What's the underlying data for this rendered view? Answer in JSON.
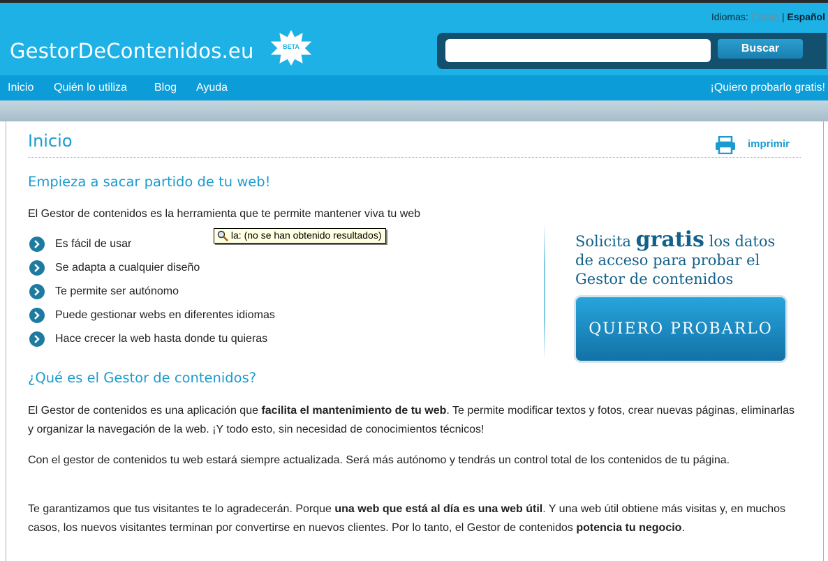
{
  "header": {
    "languages_label": "Idiomas:",
    "lang_catala": "Català",
    "lang_separator": "|",
    "lang_espanol": "Español",
    "logo_text": "GestorDeContenidos.eu",
    "beta_label": "BETA",
    "search": {
      "value": "",
      "button_label": "Buscar"
    }
  },
  "nav": {
    "items": [
      "Inicio",
      "Quién lo utiliza",
      "Blog",
      "Ayuda"
    ],
    "cta": "¡Quiero probarlo gratis!"
  },
  "main": {
    "title": "Inicio",
    "print_label": "imprimir",
    "heading1": "Empieza a sacar partido de tu web!",
    "intro": "El Gestor de contenidos es la herramienta que te permite mantener viva tu web",
    "bullets": [
      "Es fácil de usar",
      "Se adapta a cualquier diseño",
      "Te permite ser autónomo",
      "Puede gestionar webs en diferentes idiomas",
      "Hace crecer la web hasta donde tu quieras"
    ],
    "tooltip": "la: (no se han obtenido resultados)",
    "heading2": "¿Qué es el Gestor de contenidos?",
    "p1": {
      "a": "El Gestor de contenidos es una aplicación que ",
      "b": "facilita el mantenimiento de tu web",
      "c": ". Te permite modificar textos y fotos, crear nuevas páginas, eliminarlas y organizar la navegación de la web. ¡Y todo esto, sin necesidad de conocimientos técnicos!"
    },
    "p2": "Con el gestor de contenidos tu web estará siempre actualizada. Será más autónomo y tendrás un control total de los contenidos de tu página.",
    "p3": {
      "a": "Te garantizamos que tus visitantes te lo agradecerán. Porque ",
      "b": "una web que está al día es una web útil",
      "c": ". Y una web útil obtiene más visitas y, en muchos casos, los nuevos visitantes terminan por convertirse en nuevos clientes. Por lo tanto, el Gestor de contenidos ",
      "d": "potencia tu negocio",
      "e": "."
    }
  },
  "promo": {
    "line1_a": "Solicita ",
    "line1_big": "gratis",
    "line1_b": " los datos",
    "line2": "de acceso para probar el",
    "line3": "Gestor de contenidos",
    "button_label": "QUIERO PROBARLO"
  },
  "colors": {
    "header_bg": "#1eb1e6",
    "nav_bg": "#0c9cd8",
    "accent": "#1a9bd0",
    "promo_text": "#13608a"
  }
}
